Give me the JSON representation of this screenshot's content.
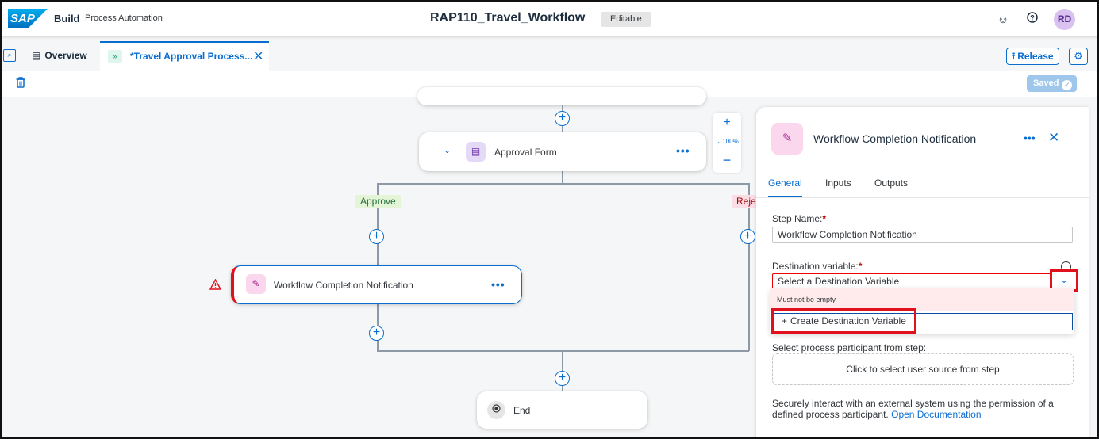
{
  "shell": {
    "logo": "SAP",
    "product": "Build",
    "subtitle": "Process Automation",
    "title": "RAP110_Travel_Workflow",
    "badge": "Editable",
    "avatar": "RD"
  },
  "tabs": {
    "overview": "Overview",
    "active": "*Travel Approval Process..."
  },
  "actions": {
    "release": "Release",
    "saved": "Saved"
  },
  "canvas": {
    "approval_form": "Approval Form",
    "approve_branch": "Approve",
    "reject_branch": "Reje",
    "notification_node": "Workflow Completion Notification",
    "end_node": "End",
    "zoom_level": "100%"
  },
  "panel": {
    "title": "Workflow Completion Notification",
    "tabs": [
      "General",
      "Inputs",
      "Outputs"
    ],
    "step_name_label": "Step Name:",
    "step_name_value": "Workflow Completion Notification",
    "destination_label": "Destination variable:",
    "destination_placeholder": "Select a Destination Variable",
    "error_message": "Must not be empty.",
    "create_destination": "Create Destination Variable",
    "participant_label": "Select process participant from step:",
    "participant_placeholder": "Click to select user source from step",
    "note_text": "Securely interact with an external system using the permission of a defined process participant.",
    "note_link": "Open Documentation"
  },
  "colors": {
    "accent": "#0a6ed1",
    "error": "#e0101c",
    "approve_bg": "#e3f5d6",
    "reject_bg": "#fbdde6"
  }
}
